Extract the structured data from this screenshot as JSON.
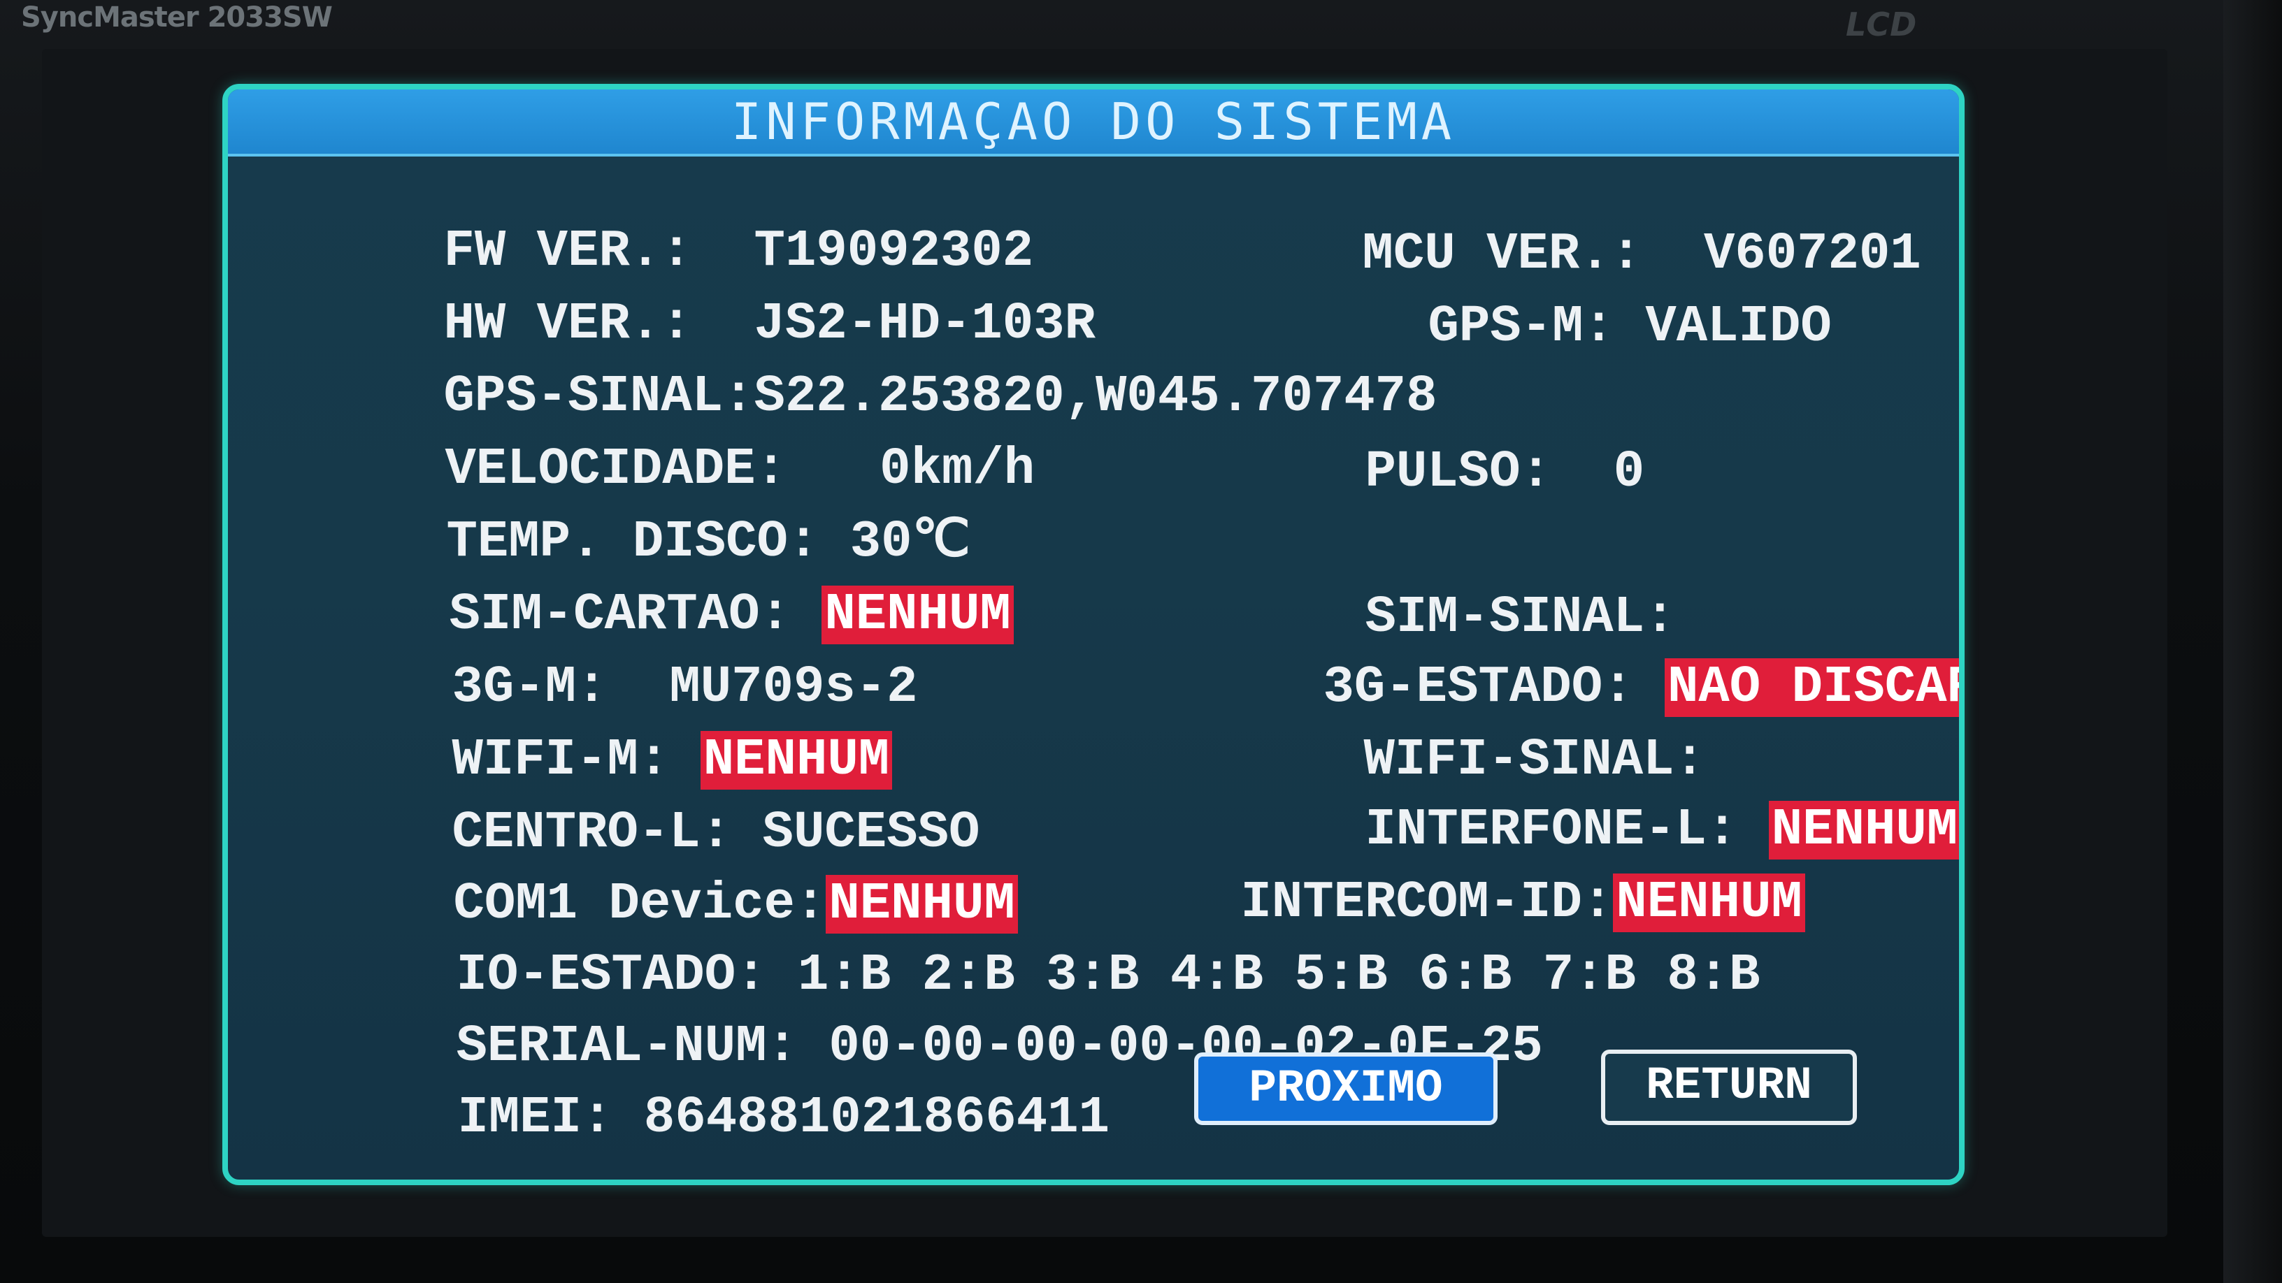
{
  "bezel": {
    "brand_left": "SyncMaster 2033SW",
    "brand_right": "LCD"
  },
  "panel": {
    "title": "INFORMAÇAO DO SISTEMA",
    "fw_ver_label": "FW VER.:",
    "fw_ver_value": "T19092302",
    "mcu_ver_label": "MCU VER.:",
    "mcu_ver_value": "V607201",
    "hw_ver_label": "HW VER.:",
    "hw_ver_value": "JS2-HD-103R",
    "gps_m_label": "GPS-M:",
    "gps_m_value": "VALIDO",
    "gps_sinal_label": "GPS-SINAL:",
    "gps_sinal_value": "S22.253820,W045.707478",
    "velocidade_label": "VELOCIDADE:",
    "velocidade_value": "0km/h",
    "pulso_label": "PULSO:",
    "pulso_value": "0",
    "temp_label": "TEMP. DISCO:",
    "temp_value": "30℃",
    "sim_cartao_label": "SIM-CARTAO:",
    "sim_cartao_value": "NENHUM",
    "sim_sinal_label": "SIM-SINAL:",
    "g3_m_label": "3G-M:",
    "g3_m_value": "MU709s-2",
    "g3_estado_label": "3G-ESTADO:",
    "g3_estado_value": "NAO DISCAR",
    "wifi_m_label": "WIFI-M:",
    "wifi_m_value": "NENHUM",
    "wifi_sinal_label": "WIFI-SINAL:",
    "centro_l_label": "CENTRO-L:",
    "centro_l_value": "SUCESSO",
    "interfone_l_label": "INTERFONE-L:",
    "interfone_l_value": "NENHUM",
    "com1_label": "COM1 Device:",
    "com1_value": "NENHUM",
    "intercom_id_label": "INTERCOM-ID:",
    "intercom_id_value": "NENHUM",
    "io_estado_label": "IO-ESTADO:",
    "io_estado_value": "1:B 2:B 3:B 4:B 5:B 6:B 7:B 8:B",
    "serial_label": "SERIAL-NUM:",
    "serial_value": "00-00-00-00-00-02-0F-25",
    "imei_label": "IMEI:",
    "imei_value": "864881021866411"
  },
  "buttons": {
    "next_label": "PROXIMO",
    "return_label": "RETURN"
  },
  "colors": {
    "panel_border": "#2ed4c4",
    "panel_bg": "#173a4c",
    "title_bar": "#2f9ee6",
    "warning_bg": "#e01e3a",
    "next_button": "#1170d8"
  }
}
